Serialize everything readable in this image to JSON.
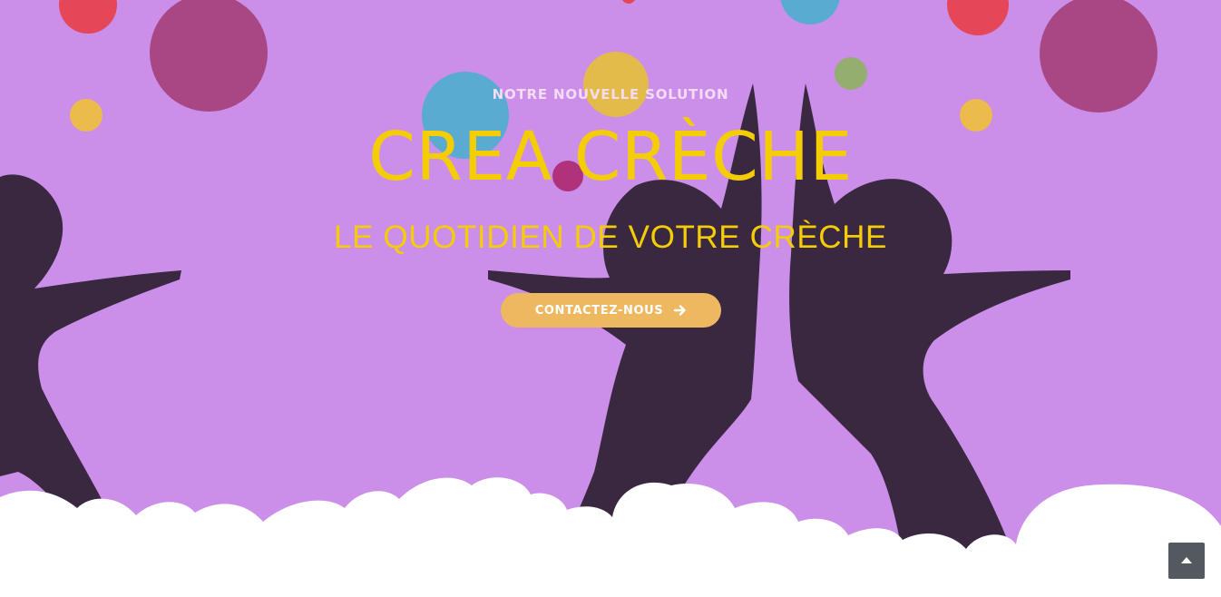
{
  "hero": {
    "kicker": "NOTRE NOUVELLE SOLUTION",
    "title": "CREA CRÈCHE",
    "subtitle": "LE QUOTIDIEN DE VOTRE CRÈCHE",
    "cta_label": "CONTACTEZ-NOUS",
    "cta_icon": "arrow-right-icon",
    "illustration": "children-silhouettes-with-balloons-and-clouds"
  },
  "scroll_top": {
    "icon": "chevron-up-icon"
  },
  "colors": {
    "background": "#cb8fea",
    "title": "#f5cd05",
    "kicker": "#f4dcf4",
    "cta_background": "#eeb861",
    "silhouette": "#3a2841",
    "clouds": "#ffffff",
    "scroll_top_background": "#54595f"
  }
}
